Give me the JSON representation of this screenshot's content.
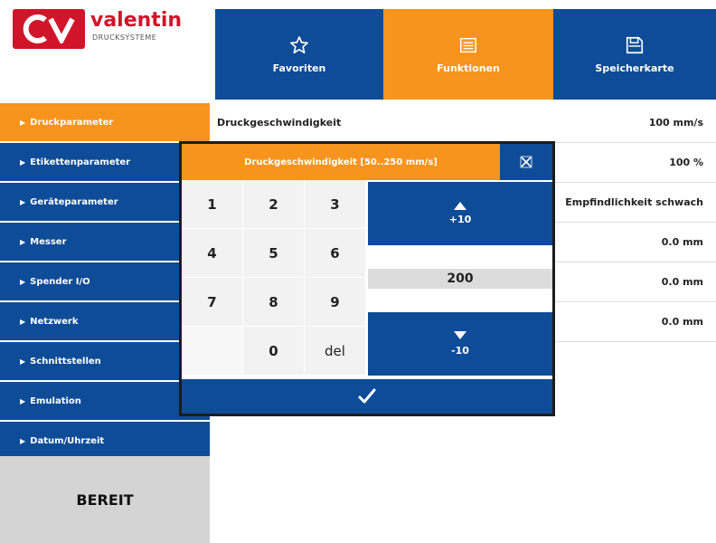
{
  "brand": {
    "name": "valentin",
    "subtitle": "DRUCKSYSTEME",
    "logo_letters": "CV",
    "color": "#d0152a"
  },
  "colors": {
    "primary": "#0e4c97",
    "accent": "#f7941d",
    "status_bg": "#d4d4d4"
  },
  "top_nav": [
    {
      "label": "Favoriten",
      "icon": "star-outline-icon"
    },
    {
      "label": "Funktionen",
      "icon": "list-icon",
      "active": true
    },
    {
      "label": "Speicherkarte",
      "icon": "memory-card-icon"
    }
  ],
  "sidebar": {
    "items": [
      {
        "label": "Druckparameter",
        "active": true
      },
      {
        "label": "Etikettenparameter"
      },
      {
        "label": "Geräteparameter"
      },
      {
        "label": "Messer"
      },
      {
        "label": "Spender I/O"
      },
      {
        "label": "Netzwerk"
      },
      {
        "label": "Schnittstellen"
      },
      {
        "label": "Emulation"
      },
      {
        "label": "Datum/Uhrzeit"
      }
    ],
    "arrow_glyph": "▶"
  },
  "status": {
    "label": "BEREIT"
  },
  "params": [
    {
      "label": "Druckgeschwindigkeit",
      "value": "100 mm/s"
    },
    {
      "label": "",
      "value": "100 %"
    },
    {
      "label": "",
      "value": "Empfindlichkeit schwach"
    },
    {
      "label": "",
      "value": "0.0 mm"
    },
    {
      "label": "",
      "value": "0.0 mm"
    },
    {
      "label": "",
      "value": "0.0 mm"
    }
  ],
  "dialog": {
    "title": "Druckgeschwindigkeit [50..250 mm/s]",
    "close_icon": "close-icon",
    "keys": [
      "1",
      "2",
      "3",
      "4",
      "5",
      "6",
      "7",
      "8",
      "9",
      "",
      "0",
      "del"
    ],
    "step_up": "+10",
    "step_down": "-10",
    "value": "200",
    "confirm_icon": "checkmark-icon"
  }
}
